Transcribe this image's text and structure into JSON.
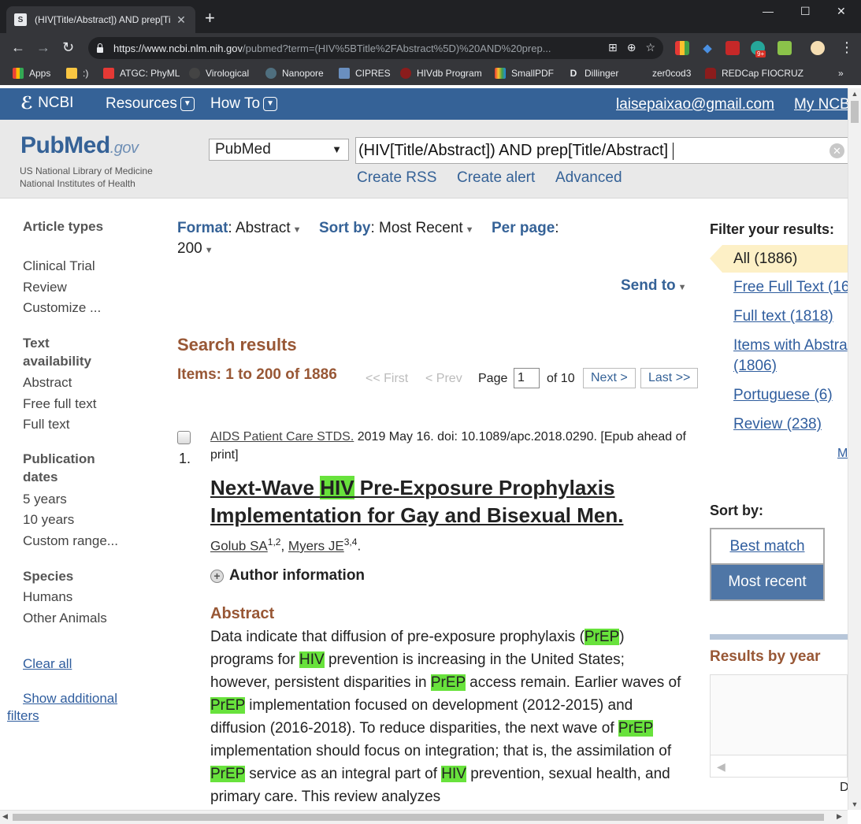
{
  "browser": {
    "tab_title": "(HIV[Title/Abstract]) AND prep[Ti",
    "tab_close": "✕",
    "new_tab": "+",
    "window_controls": [
      "—",
      "☐",
      "✕"
    ],
    "url_host": "https://www.ncbi.nlm.nih.gov",
    "url_rest": "/pubmed?term=(HIV%5BTitle%2FAbstract%5D)%20AND%20prep...",
    "bookmarks": [
      "Apps",
      ":)",
      "ATGC: PhyML",
      "Virological",
      "Nanopore",
      "CIPRES",
      "HIVdb Program",
      "SmallPDF",
      "Dillinger",
      "zer0cod3",
      "REDCap FIOCRUZ"
    ],
    "bookmarks_more": "»",
    "ext_badge": "9+"
  },
  "ncbi": {
    "logo": "NCBI",
    "resources": "Resources",
    "howto": "How To",
    "user": "laisepaixao@gmail.com",
    "my_ncbi": "My NCBI"
  },
  "pubmed": {
    "logo_pub": "Pub",
    "logo_med": "Med",
    "logo_gov": ".gov",
    "nlm": "US National Library of Medicine",
    "nih": "National Institutes of Health",
    "db_selected": "PubMed",
    "query": "(HIV[Title/Abstract]) AND prep[Title/Abstract]",
    "create_rss": "Create RSS",
    "create_alert": "Create alert",
    "advanced": "Advanced"
  },
  "sidebar": {
    "article_types": "Article types",
    "article_items": [
      "Clinical Trial",
      "Review",
      "Customize ..."
    ],
    "text_availability": "Text availability",
    "text_items": [
      "Abstract",
      "Free full text",
      "Full text"
    ],
    "pub_dates": "Publication dates",
    "date_items": [
      "5 years",
      "10 years",
      "Custom range..."
    ],
    "species": "Species",
    "species_items": [
      "Humans",
      "Other Animals"
    ],
    "clear_all": "Clear all",
    "show_additional": "Show additional",
    "filters": "filters"
  },
  "results": {
    "format_label": "Format",
    "format_value": "Abstract",
    "sortby_label": "Sort by",
    "sortby_value": "Most Recent",
    "perpage_label": "Per page",
    "perpage_value": "200",
    "send_to": "Send to",
    "title": "Search results",
    "items": "Items: 1 to 200 of 1886",
    "first": "<< First",
    "prev": "< Prev",
    "page_label": "Page",
    "page_value": "1",
    "of_pages": "of 10",
    "next": "Next >",
    "last": "Last >>"
  },
  "article": {
    "number": "1.",
    "journal": "AIDS Patient Care STDS.",
    "citation": " 2019 May 16. doi: 10.1089/apc.2018.0290. [Epub ahead of print]",
    "title_before": "Next-Wave ",
    "title_hl": "HIV",
    "title_after": " Pre-Exposure Prophylaxis Implementation for Gay and Bisexual Men.",
    "author1": "Golub SA",
    "author1_sup": "1,2",
    "author2": "Myers JE",
    "author2_sup": "3,4",
    "author_info": "Author information",
    "abstract_heading": "Abstract",
    "abstract_segments": [
      {
        "t": "Data indicate that diffusion of pre-exposure prophylaxis (",
        "h": false
      },
      {
        "t": "PrEP",
        "h": true
      },
      {
        "t": ") programs for ",
        "h": false
      },
      {
        "t": "HIV",
        "h": true
      },
      {
        "t": " prevention is increasing in the United States; however, persistent disparities in ",
        "h": false
      },
      {
        "t": "PrEP",
        "h": true
      },
      {
        "t": " access remain. Earlier waves of ",
        "h": false
      },
      {
        "t": "PrEP",
        "h": true
      },
      {
        "t": " implementation focused on development (2012-2015) and diffusion (2016-2018). To reduce disparities, the next wave of ",
        "h": false
      },
      {
        "t": "PrEP",
        "h": true
      },
      {
        "t": " implementation should focus on integration; that is, the assimilation of ",
        "h": false
      },
      {
        "t": "PrEP",
        "h": true
      },
      {
        "t": " service as an integral part of ",
        "h": false
      },
      {
        "t": "HIV",
        "h": true
      },
      {
        "t": " prevention, sexual health, and primary care. This review analyzes",
        "h": false
      }
    ]
  },
  "filters": {
    "title": "Filter your results:",
    "all": "All (1886)",
    "free_full_text": "Free Full Text (16",
    "full_text": "Full text (1818)",
    "items_with_abstract_1": "Items with Abstra",
    "items_with_abstract_2": "(1806)",
    "portuguese": "Portuguese (6)",
    "review": "Review (238)",
    "more_cut": "M",
    "sortby_title": "Sort by:",
    "best_match": "Best match",
    "most_recent": "Most recent",
    "results_by_year": "Results by year",
    "download_cut": "D"
  },
  "colors": {
    "ncbi_blue": "#356297",
    "highlight": "#68e23c",
    "heading_brown": "#985735",
    "link": "#2f5d9e"
  }
}
